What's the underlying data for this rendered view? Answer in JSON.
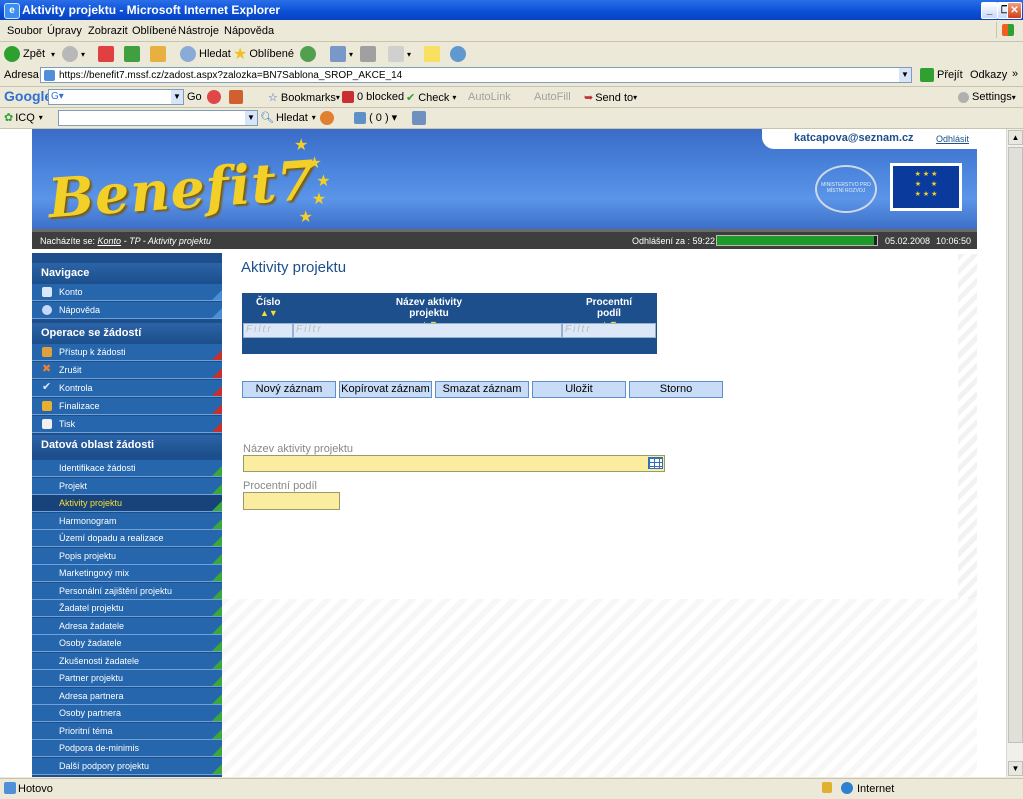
{
  "window": {
    "title": "Aktivity projektu - Microsoft Internet Explorer"
  },
  "menu": [
    "Soubor",
    "Úpravy",
    "Zobrazit",
    "Oblíbené",
    "Nástroje",
    "Nápověda"
  ],
  "toolbar": {
    "back": "Zpět",
    "search": "Hledat",
    "favorites": "Oblíbené"
  },
  "address": {
    "label": "Adresa",
    "url": "https://benefit7.mssf.cz/zadost.aspx?zalozka=BN7Sablona_SROP_AKCE_14",
    "go": "Přejít",
    "links": "Odkazy"
  },
  "google": {
    "logo": "Google",
    "go": "Go",
    "bookmarks": "Bookmarks",
    "blocked": "0 blocked",
    "check": "Check",
    "autolink": "AutoLink",
    "autofill": "AutoFill",
    "sendto": "Send to",
    "settings": "Settings"
  },
  "icq": {
    "label": "ICQ",
    "search": "Hledat",
    "count": "( 0 )"
  },
  "header": {
    "logo_text": "Benefit7",
    "user": "katcapova@seznam.cz",
    "logout": "Odhlásit",
    "ministry": "MINISTERSTVO PRO MÍSTNÍ ROZVOJ",
    "breadcrumb_prefix": "Nacházíte se:",
    "breadcrumb_link": "Konto",
    "breadcrumb_rest": "- TP - Aktivity projektu",
    "logout_timer": "Odhlášení za : 59:22",
    "session_progress": 0.98,
    "date": "05.02.2008",
    "time": "10:06:50"
  },
  "sidebar": {
    "nav_title": "Navigace",
    "nav_items": [
      "Konto",
      "Nápověda"
    ],
    "ops_title": "Operace se žádostí",
    "ops_items": [
      "Přístup k žádosti",
      "Zrušit",
      "Kontrola",
      "Finalizace",
      "Tisk"
    ],
    "data_title": "Datová oblast žádosti",
    "data_items": [
      "Identifikace žádosti",
      "Projekt",
      "Aktivity projektu",
      "Harmonogram",
      "Území dopadu a realizace",
      "Popis projektu",
      "Marketingový mix",
      "Personální zajištění projektu",
      "Žadatel projektu",
      "Adresa žadatele",
      "Osoby žadatele",
      "Zkušenosti žadatele",
      "Partner projektu",
      "Adresa partnera",
      "Osoby partnera",
      "Prioritní téma",
      "Podpora de-minimis",
      "Další podpory projektu"
    ],
    "active_item": "Aktivity projektu"
  },
  "main": {
    "title": "Aktivity projektu",
    "grid": {
      "columns": [
        "Číslo",
        "Název aktivity projektu",
        "Procentní podíl"
      ],
      "sort_glyph": "▲▼",
      "filter_placeholder": "Filtr"
    },
    "buttons": [
      "Nový záznam",
      "Kopírovat záznam",
      "Smazat záznam",
      "Uložit",
      "Storno"
    ],
    "fields": {
      "name_label": "Název aktivity projektu",
      "name_value": "",
      "share_label": "Procentní podíl",
      "share_value": ""
    }
  },
  "status": {
    "text": "Hotovo",
    "zone": "Internet"
  }
}
